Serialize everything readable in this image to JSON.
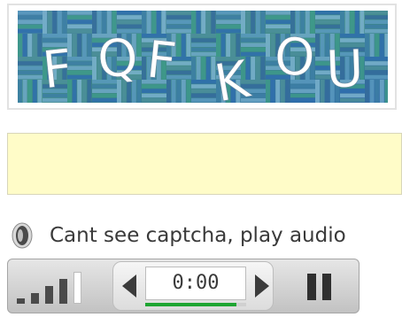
{
  "captcha": {
    "letters": [
      "F",
      "Q",
      "F",
      "K",
      "O",
      "U"
    ]
  },
  "answer": {
    "value": "",
    "placeholder": ""
  },
  "audio_link": {
    "icon": "speaker-icon",
    "label": "Cant see captcha, play audio"
  },
  "player": {
    "time": "0:00",
    "volume_level": 4,
    "volume_max": 5,
    "progress": 0.9,
    "state": "playing",
    "icons": [
      "volume-icon",
      "rewind-icon",
      "forward-icon",
      "pause-icon"
    ]
  },
  "colors": {
    "input_bg": "#fffcc8",
    "progress": "#1fa532",
    "player_bg": "#d4d4d4",
    "text": "#3a3a3a"
  }
}
